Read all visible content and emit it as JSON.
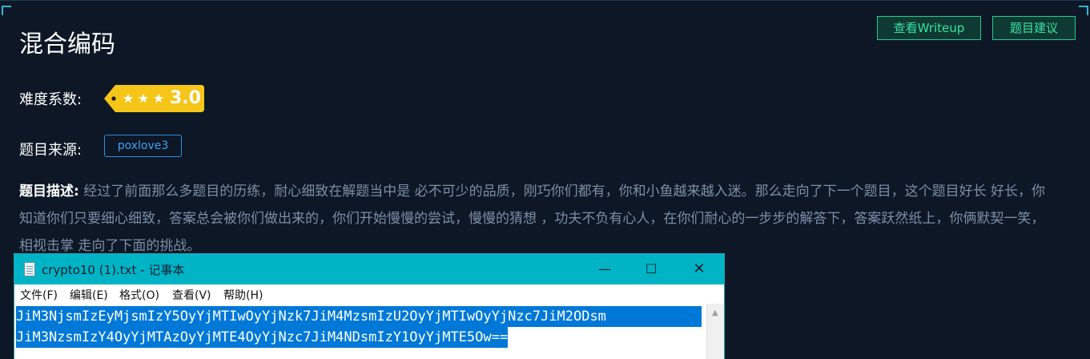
{
  "challenge": {
    "title": "混合编码",
    "buttons": {
      "writeup": "查看Writeup",
      "suggest": "题目建议"
    },
    "difficulty_label": "难度系数:",
    "difficulty_value": "3.0",
    "difficulty_stars": 3,
    "source_label": "题目来源:",
    "source_value": "poxlove3",
    "description_label": "题目描述:",
    "description_text": "经过了前面那么多题目的历练，耐心细致在解题当中是 必不可少的品质，刚巧你们都有，你和小鱼越来越入迷。那么走向了下一个题目，这个题目好长 好长，你知道你们只要细心细致，答案总会被你们做出来的，你们开始慢慢的尝试，慢慢的猜想 ，功夫不负有心人，在你们耐心的一步步的解答下，答案跃然纸上，你俩默契一笑，相视击掌 走向了下面的挑战。"
  },
  "notepad": {
    "window_title": "crypto10 (1).txt - 记事本",
    "menus": [
      "文件(F)",
      "编辑(E)",
      "格式(O)",
      "查看(V)",
      "帮助(H)"
    ],
    "lines": [
      "JiM3NjsmIzEyMjsmIzY5OyYjMTIwOyYjNzk7JiM4MzsmIzU2OyYjMTIwOyYjNzc7JiM2ODsm",
      "JiM3NzsmIzY4OyYjMTAzOyYjMTE4OyYjNzc7JiM4NDsmIzY1OyYjMTE5Ow=="
    ]
  },
  "colors": {
    "background": "#0d1726",
    "accent_green": "#38e3a1",
    "accent_blue": "#3fa0f0",
    "badge_yellow": "#f5c518",
    "titlebar": "#00b4c6",
    "selection": "#0078d7"
  }
}
